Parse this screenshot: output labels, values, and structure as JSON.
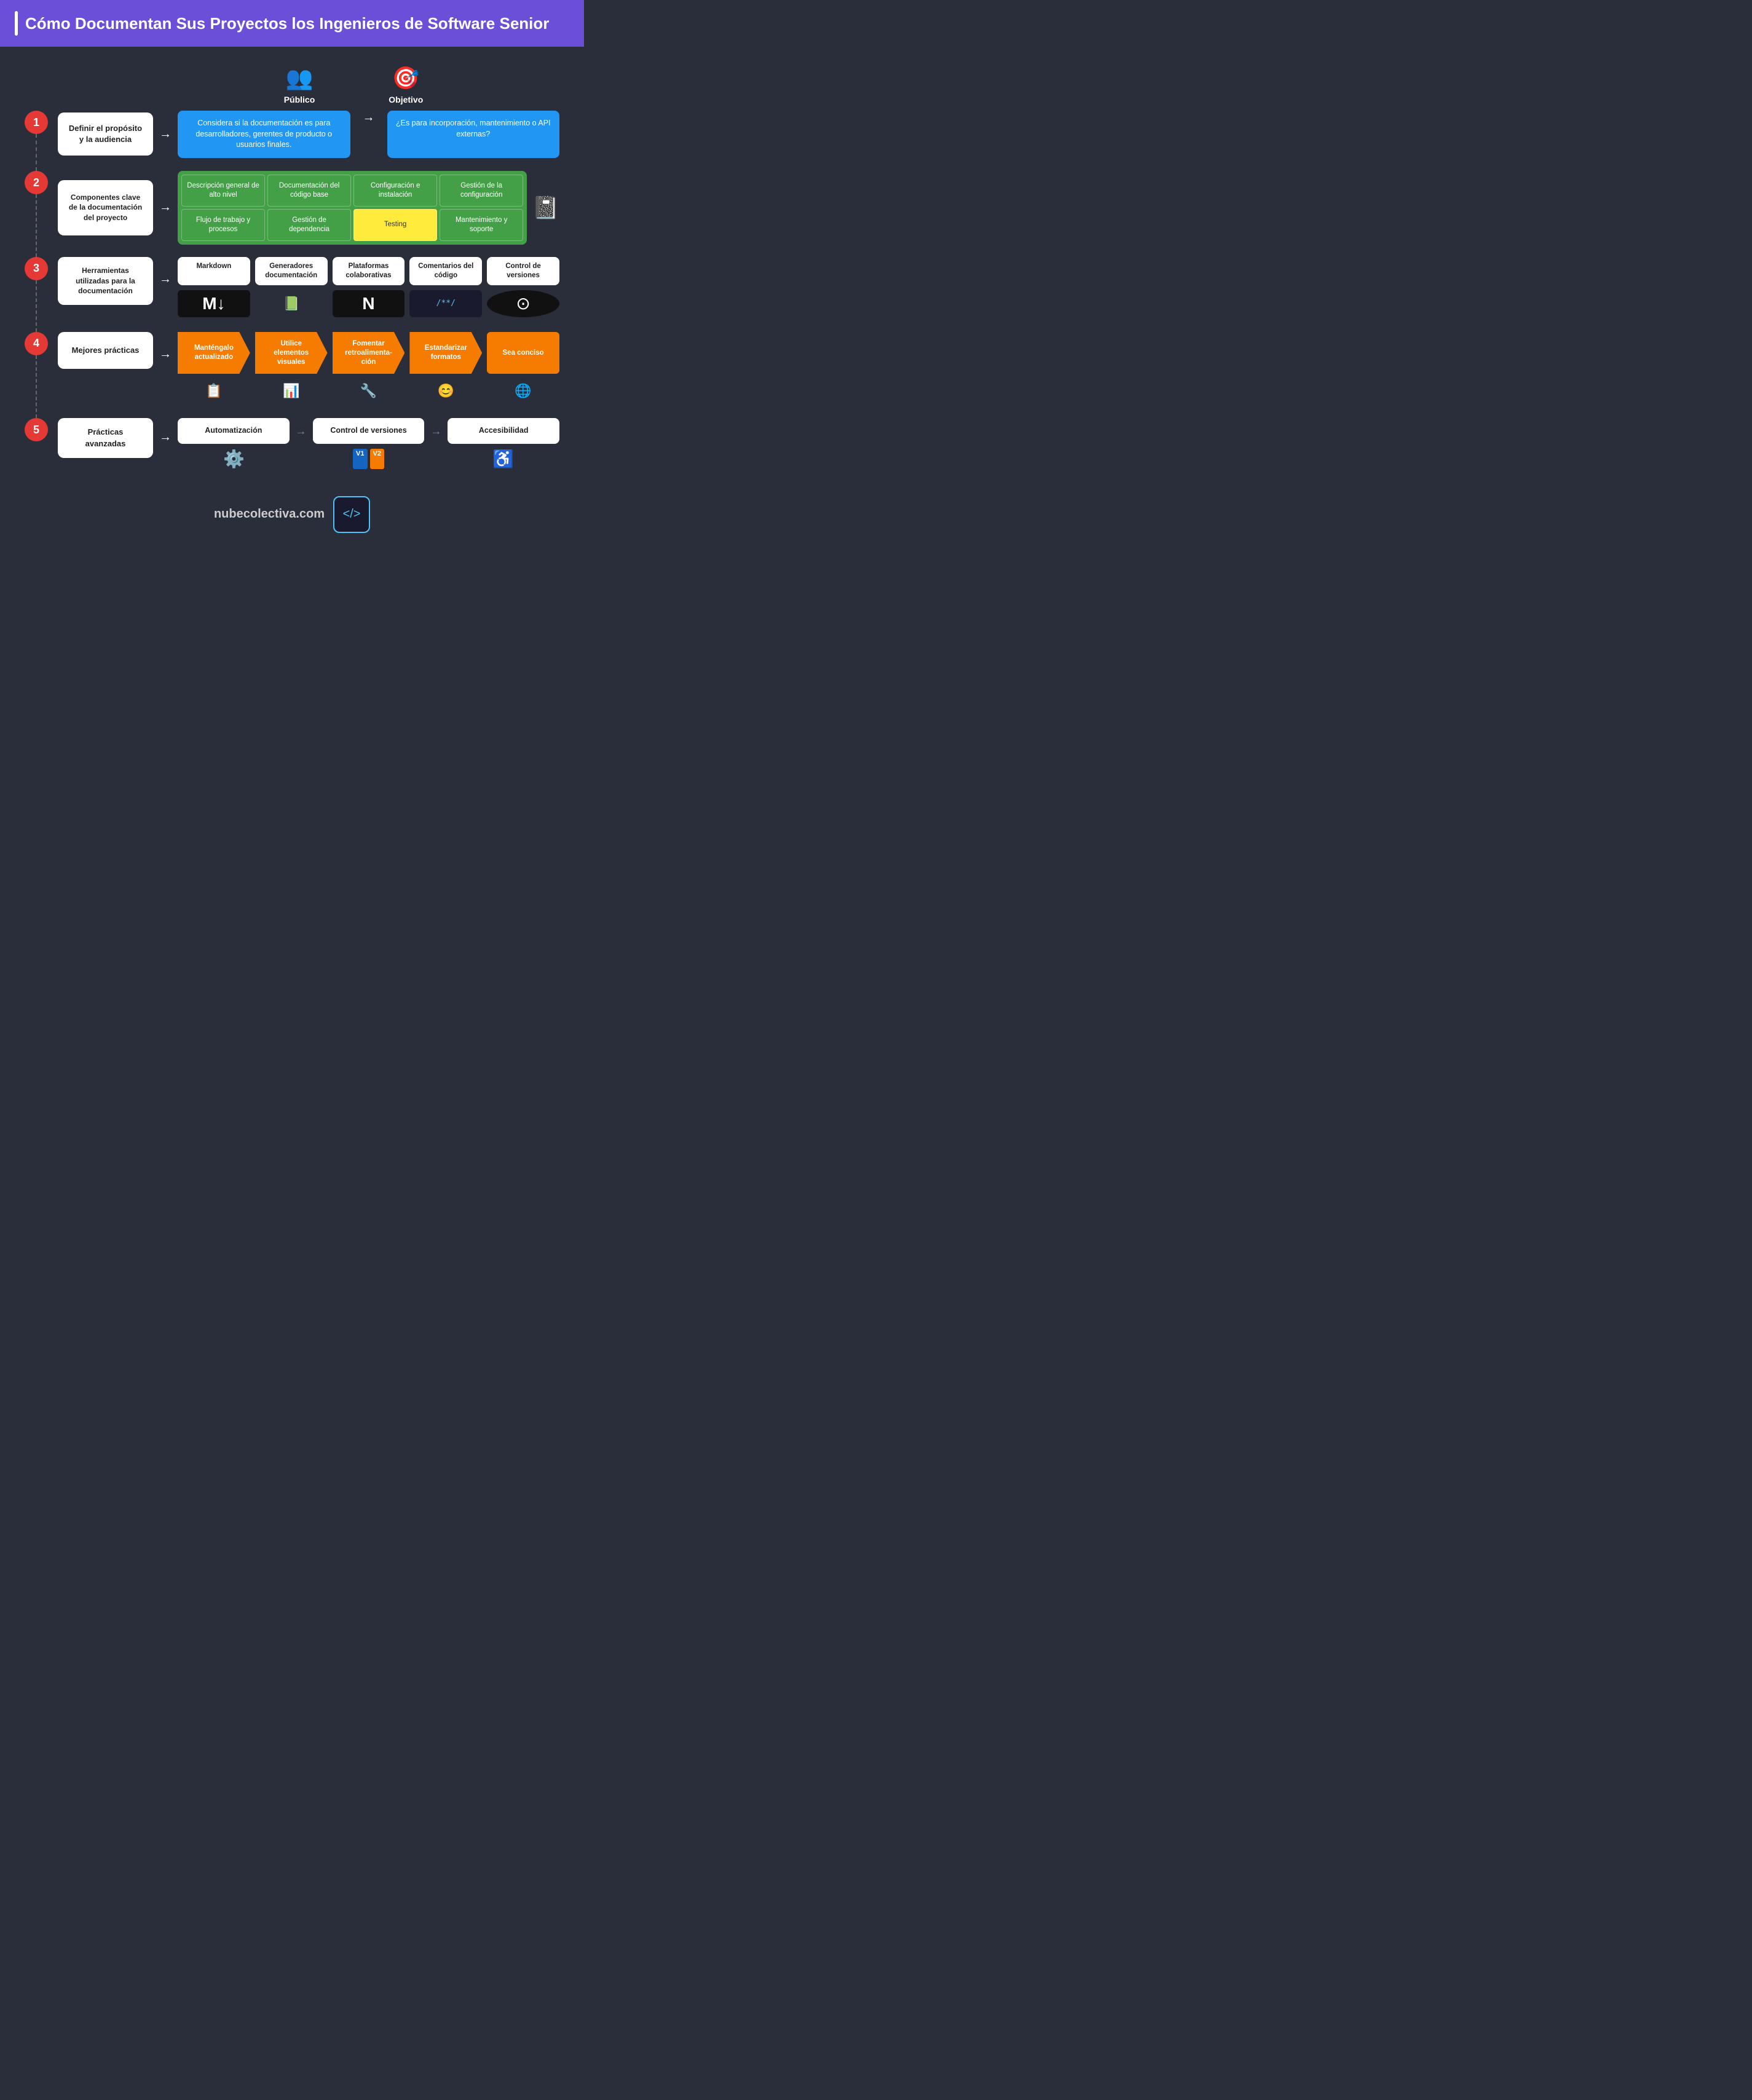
{
  "header": {
    "title": "Cómo Documentan Sus Proyectos los Ingenieros de Software Senior"
  },
  "top_icons": [
    {
      "icon": "👥",
      "label": "Público"
    },
    {
      "icon": "🎯",
      "label": "Objetivo"
    }
  ],
  "steps": [
    {
      "num": "1",
      "box_text": "Definir el propósito y la audiencia",
      "content_type": "blue_boxes",
      "blue_boxes": [
        "Considera si la documentación es para desarrolladores, gerentes de producto o usuarios finales.",
        "¿Es para incorporación, mantenimiento o API externas?"
      ]
    },
    {
      "num": "2",
      "box_text": "Componentes clave de la documentación del proyecto",
      "content_type": "green_grid",
      "green_cells": [
        {
          "text": "Descripción general de alto nivel",
          "highlight": false
        },
        {
          "text": "Documentación del código base",
          "highlight": false
        },
        {
          "text": "Configuración e instalación",
          "highlight": false
        },
        {
          "text": "Gestión de la configuración",
          "highlight": false
        },
        {
          "text": "Flujo de trabajo y procesos",
          "highlight": false
        },
        {
          "text": "Gestión de dependencia",
          "highlight": false
        },
        {
          "text": "Testing",
          "highlight": true
        },
        {
          "text": "Mantenimiento y soporte",
          "highlight": false
        }
      ]
    },
    {
      "num": "3",
      "box_text": "Herramientas utilizadas para la documentación",
      "content_type": "tools",
      "tools": [
        {
          "label": "Markdown",
          "icon": "M↓"
        },
        {
          "label": "Generadores documentación",
          "icon": "📋"
        },
        {
          "label": "Plataformas colaborativas",
          "icon": "N"
        },
        {
          "label": "Comentarios del código",
          "icon": "/**/"
        },
        {
          "label": "Control de versiones",
          "icon": "⚙"
        }
      ]
    },
    {
      "num": "4",
      "box_text": "Mejores prácticas",
      "content_type": "pentagons",
      "pentagons": [
        {
          "text": "Manténgalo actualizado",
          "icon": "📋"
        },
        {
          "text": "Utilice elementos visuales",
          "icon": "📊"
        },
        {
          "text": "Fomentar retroalimenta-ción",
          "icon": "🔧"
        },
        {
          "text": "Estandarizar formatos",
          "icon": "😊"
        },
        {
          "text": "Sea conciso",
          "icon": "🌐"
        }
      ]
    },
    {
      "num": "5",
      "box_text": "Prácticas avanzadas",
      "content_type": "advanced",
      "advanced": [
        {
          "text": "Automatización",
          "icon": "⚙"
        },
        {
          "text": "Control de versiones",
          "icon": "V1 V2"
        },
        {
          "text": "Accesibilidad",
          "icon": "♿"
        }
      ]
    }
  ],
  "footer": {
    "url": "nubecolectiva.com",
    "logo_text": "</>"
  }
}
